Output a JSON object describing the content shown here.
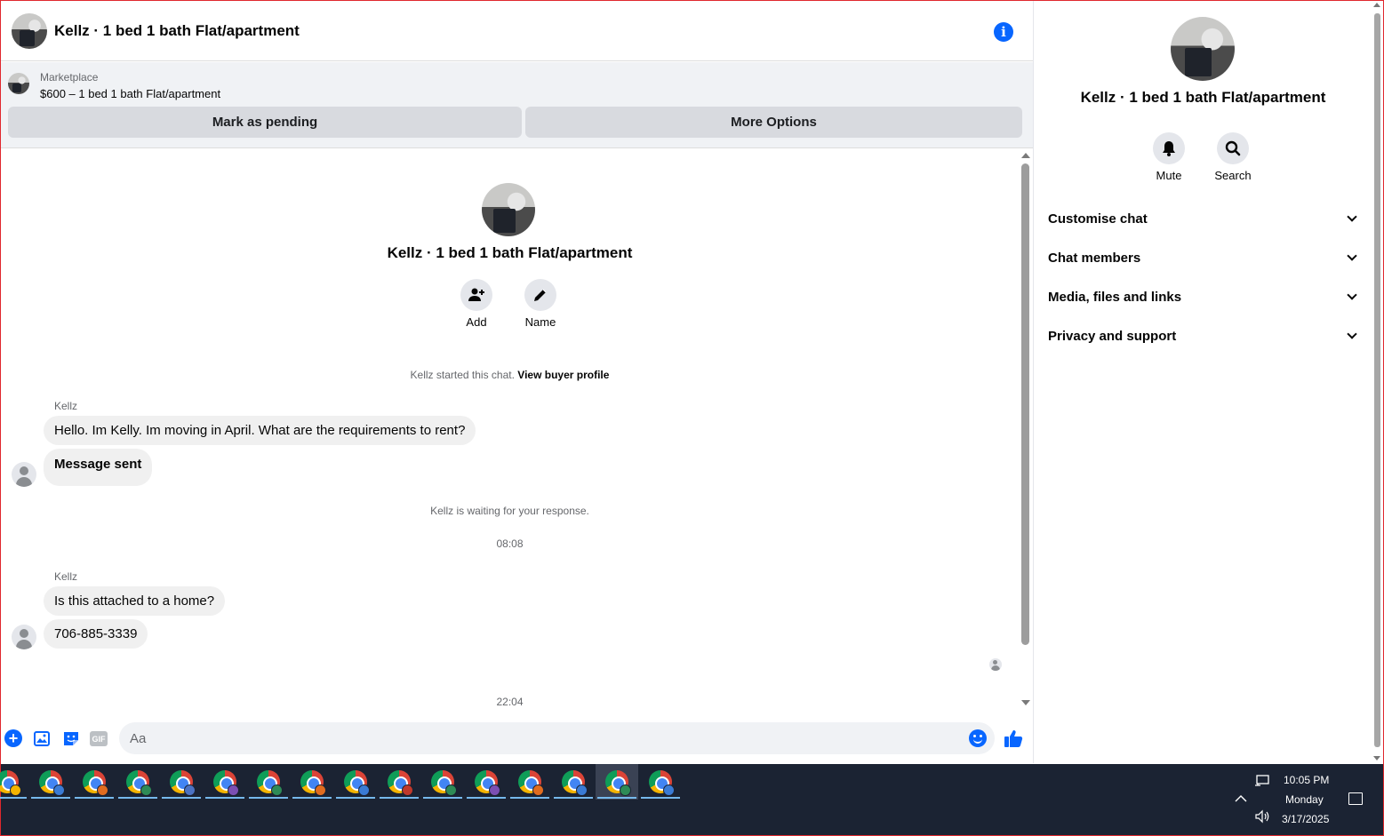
{
  "header": {
    "title": "Kellz · 1 bed 1 bath Flat/apartment"
  },
  "marketplace": {
    "label": "Marketplace",
    "listing": "$600 – 1 bed 1 bath Flat/apartment",
    "mark_pending": "Mark as pending",
    "more_options": "More Options"
  },
  "thread": {
    "title": "Kellz · 1 bed 1 bath Flat/apartment",
    "add_label": "Add",
    "name_label": "Name",
    "started": "Kellz started this chat.",
    "view_profile": "View buyer profile",
    "waiting": "Kellz is waiting for your response.",
    "messages_group1": {
      "sender": "Kellz",
      "msg1": "Hello. Im Kelly. Im moving in April. What are the requirements to rent?",
      "msg2": "Message sent"
    },
    "time1": "08:08",
    "messages_group2": {
      "sender": "Kellz",
      "msg1": "Is this attached to a home?",
      "msg2": "706-885-3339"
    },
    "time2": "22:04"
  },
  "composer": {
    "placeholder": "Aa",
    "gif_label": "GIF"
  },
  "panel": {
    "title": "Kellz · 1 bed 1 bath Flat/apartment",
    "mute_label": "Mute",
    "search_label": "Search",
    "sections": [
      "Customise chat",
      "Chat members",
      "Media, files and links",
      "Privacy and support"
    ]
  },
  "taskbar": {
    "time": "10:05 PM",
    "day": "Monday",
    "date": "3/17/2025",
    "apps": [
      "chrome-icon",
      "chrome-icon",
      "chrome-icon",
      "chrome-icon",
      "chrome-icon",
      "chrome-icon",
      "chrome-icon",
      "chrome-icon",
      "chrome-icon",
      "chrome-icon",
      "chrome-icon",
      "chrome-icon",
      "chrome-icon",
      "chrome-icon",
      "chrome-icon",
      "chrome-icon"
    ]
  },
  "colors": {
    "accent": "#0866ff",
    "taskbar": "#1b2333",
    "bubble": "#f0f0f0"
  }
}
